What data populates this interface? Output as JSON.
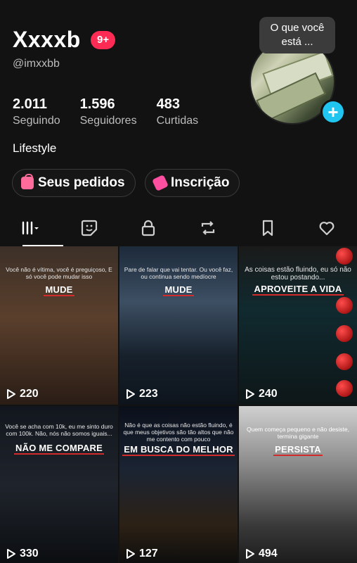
{
  "profile": {
    "name": "Xxxxb",
    "notification_count": "9+",
    "handle": "@imxxbb",
    "status_bubble": "O que você está ...",
    "stats": [
      {
        "value": "2.011",
        "label": "Seguindo"
      },
      {
        "value": "1.596",
        "label": "Seguidores"
      },
      {
        "value": "483",
        "label": "Curtidas"
      }
    ],
    "bio": "Lifestyle",
    "buttons": {
      "orders": "Seus pedidos",
      "subscription": "Inscrição"
    }
  },
  "tabs": [
    {
      "name": "videos",
      "icon": "grid-icon",
      "active": true
    },
    {
      "name": "stickers",
      "icon": "sticker-icon"
    },
    {
      "name": "private",
      "icon": "lock-icon"
    },
    {
      "name": "reposts",
      "icon": "repost-icon"
    },
    {
      "name": "favorites",
      "icon": "bookmark-icon"
    },
    {
      "name": "liked",
      "icon": "heart-icon"
    }
  ],
  "videos": [
    {
      "caption": "Você não é vítima, você é preguiçoso, E só você pode mudar isso",
      "highlight": "MUDE",
      "views": "220"
    },
    {
      "caption": "Pare de falar que vai tentar. Ou você faz, ou continua sendo medíocre",
      "highlight": "MUDE",
      "views": "223"
    },
    {
      "caption": "As coisas estão fluindo, eu só não estou postando...",
      "highlight": "APROVEITE A VIDA",
      "views": "240"
    },
    {
      "caption": "Você se acha com 10k, eu me sinto duro com 100k. Não, nós não somos iguais...",
      "highlight": "NÃO ME COMPARE",
      "views": "330"
    },
    {
      "caption": "Não é que as coisas não estão fluindo, é que meus objetivos são tão altos que não me contento com pouco",
      "highlight": "EM BUSCA DO MELHOR",
      "views": "127"
    },
    {
      "caption": "Quem começa pequeno e não desiste, termina gigante",
      "highlight": "PERSISTA",
      "views": "494"
    }
  ],
  "colors": {
    "background": "#121212",
    "accent_red": "#fe2c55",
    "add_button": "#20c5f0",
    "secondary_text": "#bdbdbd"
  }
}
